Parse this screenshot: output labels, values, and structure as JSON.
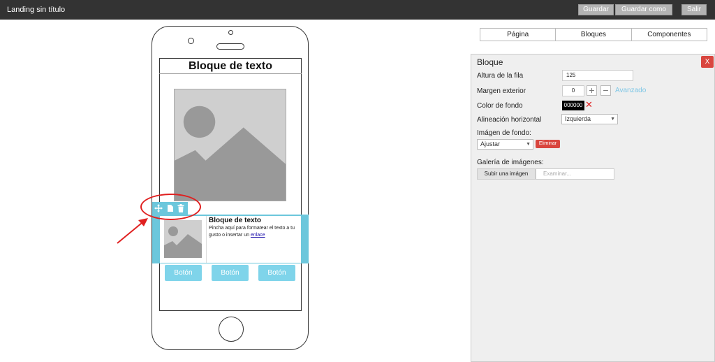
{
  "app": {
    "title": "Landing sin título",
    "buttons": {
      "save": "Guardar",
      "save_as": "Guardar como",
      "exit": "Salir"
    }
  },
  "phone": {
    "block_title": "Bloque de texto",
    "text_block": {
      "title": "Bloque de texto",
      "body": "Pincha aquí para formatear el texto a tu gusto o insertar un ",
      "link": "enlace"
    },
    "toolbar_icons": [
      "move-icon",
      "copy-icon",
      "trash-icon"
    ],
    "buttons": [
      "Botón",
      "Botón",
      "Botón"
    ]
  },
  "tabs": [
    "Página",
    "Bloques",
    "Componentes"
  ],
  "panel": {
    "title": "Bloque",
    "close": "X",
    "row_height_label": "Altura de la fila",
    "row_height_value": "125",
    "margin_label": "Margen exterior",
    "margin_value": "0",
    "margin_plus": "+",
    "margin_minus": "−",
    "advanced": "Avanzado",
    "bg_color_label": "Color de fondo",
    "bg_color_value": "000000",
    "bg_color_clear": "✕",
    "halign_label": "Alineación horizontal",
    "halign_value": "Izquierda",
    "bg_image_label": "Imágen de fondo:",
    "bg_image_mode": "Ajustar",
    "delete": "Eliminar",
    "gallery_label": "Galería de imágenes:",
    "upload": "Subir una imágen",
    "browse_placeholder": "Examinar..."
  },
  "colors": {
    "topbar": "#333333",
    "selection": "#6cc7dc",
    "phone_button": "#7fd4ea",
    "danger": "#d9463f",
    "annotation": "#e02020"
  }
}
